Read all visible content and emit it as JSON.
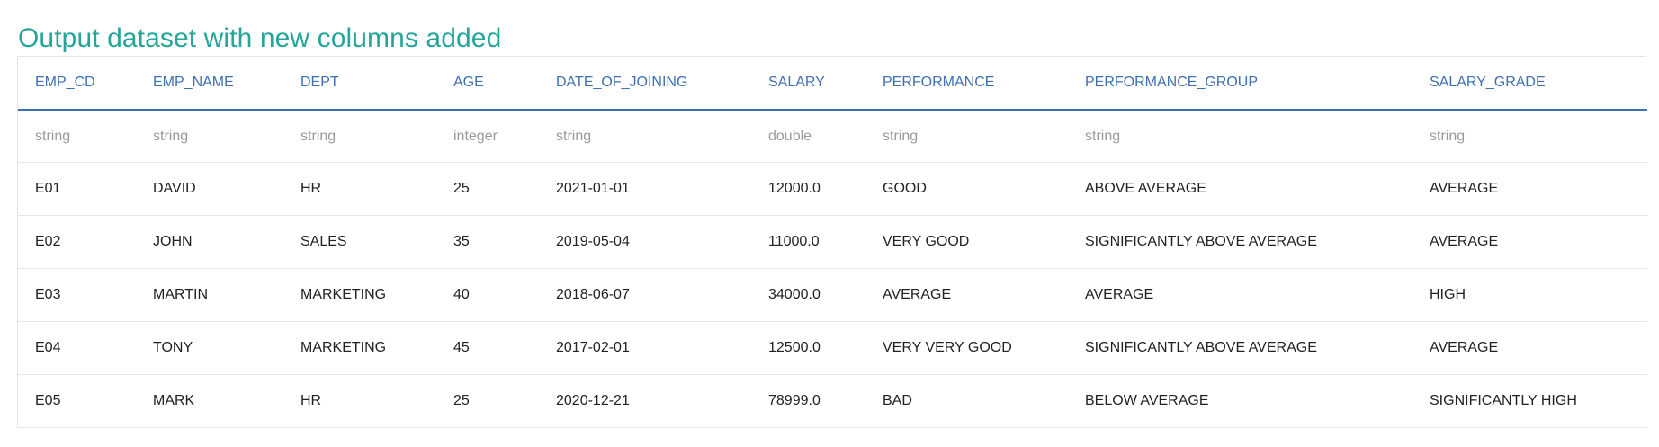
{
  "title": "Output dataset with new columns added",
  "table": {
    "columns": [
      "EMP_CD",
      "EMP_NAME",
      "DEPT",
      "AGE",
      "DATE_OF_JOINING",
      "SALARY",
      "PERFORMANCE",
      "PERFORMANCE_GROUP",
      "SALARY_GRADE"
    ],
    "types": [
      "string",
      "string",
      "string",
      "integer",
      "string",
      "double",
      "string",
      "string",
      "string"
    ],
    "rows": [
      [
        "E01",
        "DAVID",
        "HR",
        "25",
        "2021-01-01",
        "12000.0",
        "GOOD",
        "ABOVE AVERAGE",
        "AVERAGE"
      ],
      [
        "E02",
        "JOHN",
        "SALES",
        "35",
        "2019-05-04",
        "11000.0",
        "VERY GOOD",
        "SIGNIFICANTLY ABOVE AVERAGE",
        "AVERAGE"
      ],
      [
        "E03",
        "MARTIN",
        "MARKETING",
        "40",
        "2018-06-07",
        "34000.0",
        "AVERAGE",
        "AVERAGE",
        "HIGH"
      ],
      [
        "E04",
        "TONY",
        "MARKETING",
        "45",
        "2017-02-01",
        "12500.0",
        "VERY VERY GOOD",
        "SIGNIFICANTLY ABOVE AVERAGE",
        "AVERAGE"
      ],
      [
        "E05",
        "MARK",
        "HR",
        "25",
        "2020-12-21",
        "78999.0",
        "BAD",
        "BELOW AVERAGE",
        "SIGNIFICANTLY HIGH"
      ]
    ]
  },
  "colors": {
    "title": "#26a69a",
    "header": "#3e6fb0",
    "type_text": "#9a9a9a",
    "border": "#e6e6e6"
  }
}
